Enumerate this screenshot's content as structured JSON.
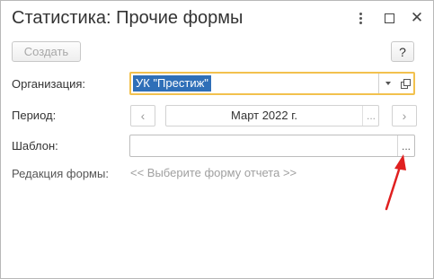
{
  "window": {
    "title": "Статистика: Прочие формы",
    "controls": {
      "more_icon": "kebab-icon",
      "maximize_icon": "maximize-icon",
      "close_glyph": "✕"
    }
  },
  "toolbar": {
    "create_label": "Создать",
    "help_label": "?"
  },
  "form": {
    "organization": {
      "label": "Организация:",
      "value": "УК \"Престиж\"",
      "dropdown_icon": "chevron-down-icon",
      "open_icon": "open-item-icon"
    },
    "period": {
      "label": "Период:",
      "prev_glyph": "‹",
      "value": "Март 2022 г.",
      "select_glyph": "...",
      "next_glyph": "›"
    },
    "template": {
      "label": "Шаблон:",
      "value": "",
      "select_glyph": "..."
    },
    "edition": {
      "label": "Редакция формы:",
      "value": "<< Выберите форму отчета >>"
    }
  },
  "annotation": {
    "arrow_color": "#e02020",
    "points_to": "template-select-button"
  },
  "colors": {
    "focus_border": "#f2c14e",
    "selection_bg": "#2f6fb8",
    "hint_text": "#a0a0a0"
  }
}
